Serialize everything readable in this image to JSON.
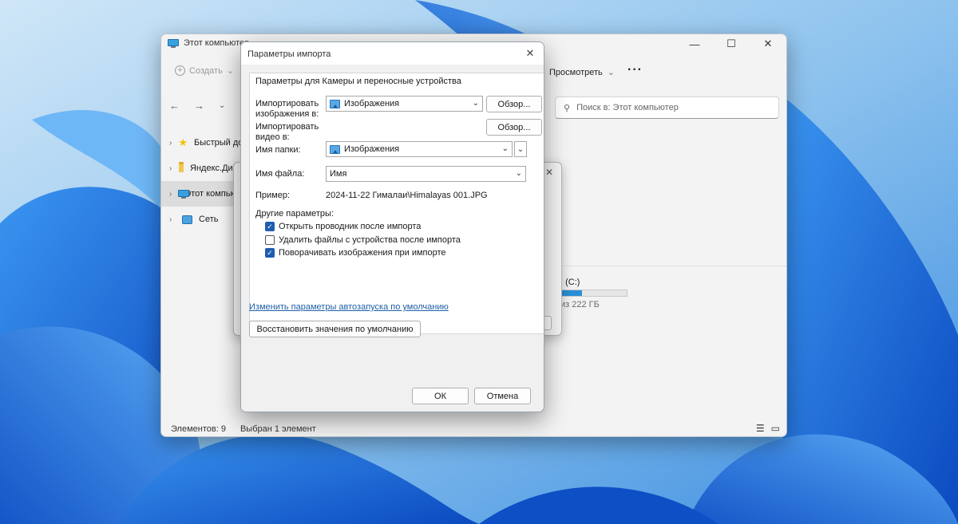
{
  "colors": {
    "accent": "#1e5db0",
    "link": "#1e5fa8",
    "drive_fill": "#2b8fd6"
  },
  "explorer": {
    "title": "Этот компьютер",
    "controls": {
      "minimize": "—",
      "maximize": "☐",
      "close": "✕"
    },
    "toolbar": {
      "create": "Создать",
      "view": "Просмотреть",
      "more": "···"
    },
    "nav": {
      "back": "←",
      "forward": "→",
      "recent": "⌄",
      "up": "↑"
    },
    "search_placeholder": "Поиск в: Этот компьютер",
    "sidebar": [
      {
        "label": "Быстрый доступ",
        "icon": "star-icon"
      },
      {
        "label": "Яндекс.Диск",
        "icon": "folder-icon"
      },
      {
        "label": "Этот компьютер",
        "icon": "monitor-icon",
        "active": true
      },
      {
        "label": "Сеть",
        "icon": "network-icon"
      }
    ],
    "drive": {
      "label": ": (C:)",
      "size": "из 222 ГБ",
      "used_fraction": 0.32
    },
    "status": {
      "items": "Элементов: 9",
      "selected": "Выбран 1 элемент"
    }
  },
  "dialog": {
    "title": "Параметры импорта",
    "close": "✕",
    "group_title": "Параметры для Камеры и переносные устройства",
    "import_images_label": "Импортировать изображения в:",
    "import_images_value": "Изображения",
    "import_video_label": "Импортировать видео в:",
    "browse": "Обзор...",
    "folder_name_label": "Имя папки:",
    "folder_name_value": "Изображения",
    "file_name_label": "Имя файла:",
    "file_name_value": "Имя",
    "example_label": "Пример:",
    "example_value": "2024-11-22 Гималаи\\Himalayas 001.JPG",
    "other_label": "Другие параметры:",
    "options": [
      {
        "label": "Открыть проводник после импорта",
        "checked": true
      },
      {
        "label": "Удалить файлы с устройства после импорта",
        "checked": false
      },
      {
        "label": "Поворачивать изображения при импорте",
        "checked": true
      }
    ],
    "autoplay_link": "Изменить параметры автозапуска по умолчанию",
    "restore_button": "Восстановить значения по умолчанию",
    "ok": "ОК",
    "cancel": "Отмена"
  }
}
